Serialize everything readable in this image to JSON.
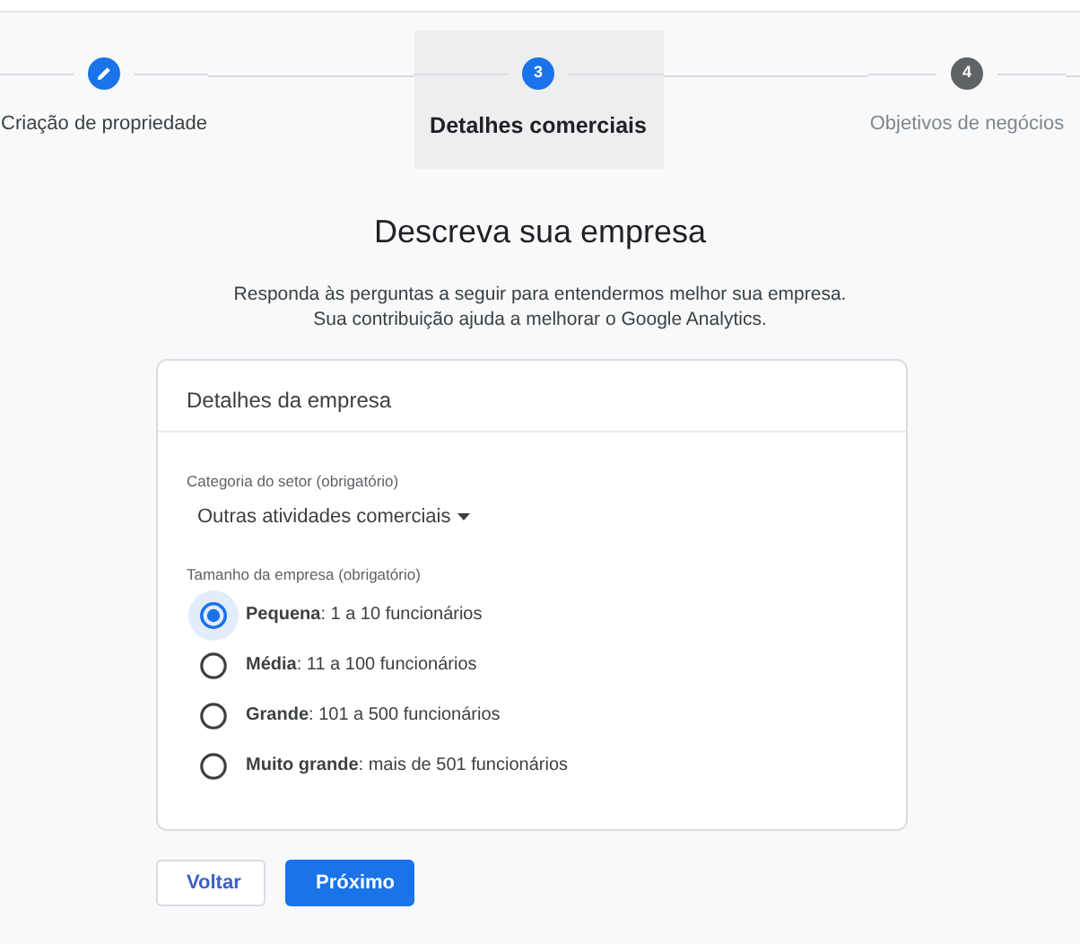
{
  "steps": [
    {
      "label": "Criação de propriedade",
      "kind": "done",
      "selected": false
    },
    {
      "number": "3",
      "label": "Detalhes comerciais",
      "kind": "current",
      "selected": true
    },
    {
      "number": "4",
      "label": "Objetivos de negócios",
      "kind": "upcoming",
      "selected": false
    }
  ],
  "heading": "Descreva sua empresa",
  "intro": [
    "Responda às perguntas a seguir para entendermos melhor sua empresa.",
    "Sua contribuição ajuda a melhorar o Google Analytics."
  ],
  "card": {
    "title": "Detalhes da empresa",
    "category": {
      "label": "Categoria do setor (obrigatório)",
      "value": "Outras atividades comerciais"
    },
    "size": {
      "label": "Tamanho da empresa (obrigatório)",
      "options": [
        {
          "text": "**Pequena**: 1 a 10 funcionários",
          "selected": true
        },
        {
          "text": "**Média**: 11 a 100 funcionários",
          "selected": false
        },
        {
          "text": "**Grande**: 101 a 500 funcionários",
          "selected": false
        },
        {
          "text": "**Muito grande**: mais de 501 funcionários",
          "selected": false
        }
      ]
    }
  },
  "buttons": [
    {
      "label": "Voltar",
      "kind": "secondary"
    },
    {
      "label": "Próximo",
      "kind": "primary"
    }
  ]
}
